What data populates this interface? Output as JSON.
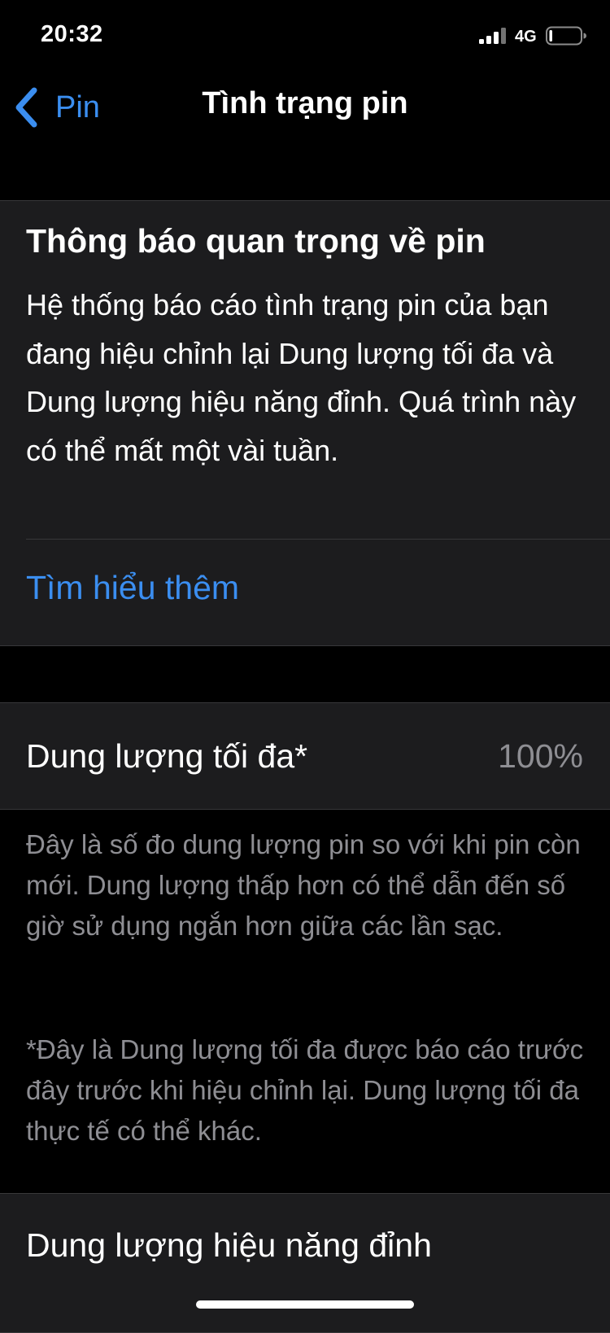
{
  "status_bar": {
    "time": "20:32",
    "network": "4G",
    "signal_icon": "signal-bars-icon",
    "battery_icon": "battery-icon"
  },
  "nav": {
    "back_label": "Pin",
    "back_icon": "chevron-left-icon",
    "title": "Tình trạng pin"
  },
  "notice": {
    "title": "Thông báo quan trọng về pin",
    "body": "Hệ thống báo cáo tình trạng pin của bạn đang hiệu chỉnh lại Dung lượng tối đa và Dung lượng hiệu năng đỉnh. Quá trình này có thể mất một vài tuần.",
    "link": "Tìm hiểu thêm"
  },
  "max_capacity": {
    "label": "Dung lượng tối đa*",
    "value": "100%"
  },
  "footer": {
    "description": "Đây là số đo dung lượng pin so với khi pin còn mới. Dung lượng thấp hơn có thể dẫn đến số giờ sử dụng ngắn hơn giữa các lần sạc.",
    "note": "*Đây là Dung lượng tối đa được báo cáo trước đây trước khi hiệu chỉnh lại. Dung lượng tối đa thực tế có thể khác."
  },
  "peak": {
    "label": "Dung lượng hiệu năng đỉnh"
  },
  "colors": {
    "background": "#000000",
    "cell_background": "#1c1c1e",
    "accent": "#3b8ef0",
    "secondary_text": "#8e8e93",
    "separator": "#38383a"
  }
}
